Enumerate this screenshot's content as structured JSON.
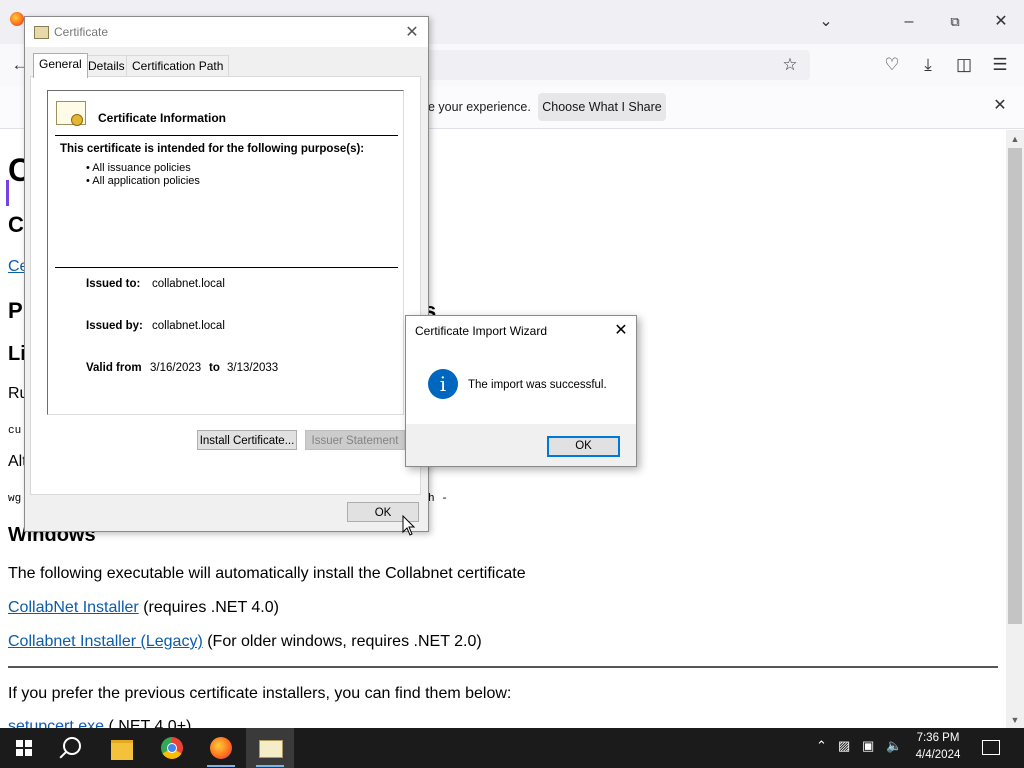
{
  "browser": {
    "notification": {
      "text": "e your experience.",
      "button": "Choose What I Share"
    }
  },
  "page": {
    "h1_fragment": "C",
    "h2_fragment": "C",
    "link_fragment": "Ce",
    "heading_p": "P",
    "heading_p_tail": "s",
    "heading_li": "Li",
    "text_ru": "Ru",
    "code_cu": "cu",
    "text_alt": "Alt",
    "code_wg": "wg",
    "code_wg_tail": "h  -",
    "windows_heading": "Windows",
    "windows_desc": "The following executable will automatically install the Collabnet certificate",
    "installer_link": "CollabNet Installer",
    "installer_req": "(requires .NET 4.0)",
    "legacy_link": "Collabnet Installer (Legacy)",
    "legacy_req": "(For older windows, requires .NET 2.0)",
    "previous_text": "If you prefer the previous certificate installers, you can find them below:",
    "setupcert_link": "setupcert.exe",
    "setupcert_req": "(.NET 4.0+)"
  },
  "cert_dialog": {
    "title": "Certificate",
    "tabs": [
      "General",
      "Details",
      "Certification Path"
    ],
    "info_title": "Certificate Information",
    "purpose_heading": "This certificate is intended for the following purpose(s):",
    "purposes": [
      "• All issuance policies",
      "• All application policies"
    ],
    "issued_to_label": "Issued to:",
    "issued_to": "collabnet.local",
    "issued_by_label": "Issued by:",
    "issued_by": "collabnet.local",
    "valid_from_label": "Valid from",
    "valid_from": "3/16/2023",
    "to_label": "to",
    "valid_to": "3/13/2033",
    "install_button": "Install Certificate...",
    "issuer_button": "Issuer Statement",
    "ok_button": "OK"
  },
  "wizard": {
    "title": "Certificate Import Wizard",
    "message": "The import was successful.",
    "ok_button": "OK",
    "icon": "info-icon"
  },
  "taskbar": {
    "time": "7:36 PM",
    "date": "4/4/2024",
    "apps": [
      "start",
      "search",
      "file-explorer",
      "chrome",
      "firefox",
      "certificate-manager"
    ]
  }
}
